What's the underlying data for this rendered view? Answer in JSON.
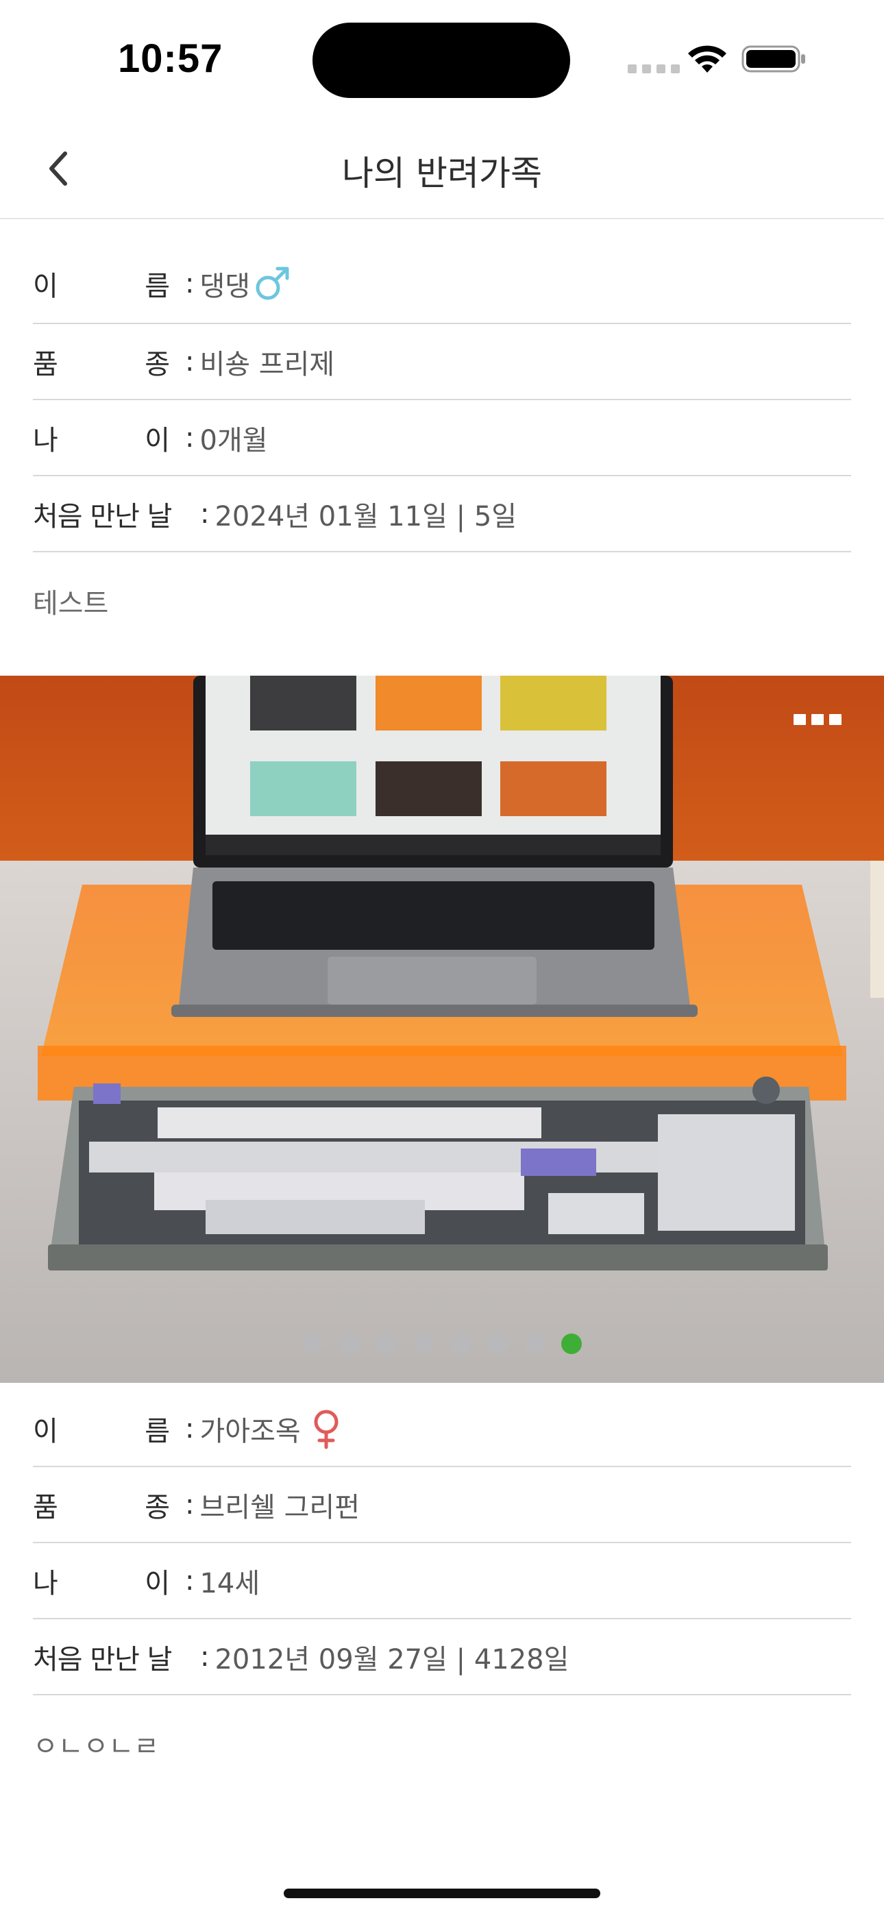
{
  "status_bar": {
    "time": "10:57"
  },
  "nav": {
    "title": "나의 반려가족"
  },
  "pets": [
    {
      "name_label_a": "이",
      "name_label_b": "름",
      "breed_label_a": "품",
      "breed_label_b": "종",
      "age_label_a": "나",
      "age_label_b": "이",
      "met_label": "처음 만난 날",
      "colon": ":",
      "name": "댕댕",
      "gender_icon": "male-icon",
      "breed": "비숑 프리제",
      "age": "0개월",
      "met": "2024년 01월 11일 | 5일",
      "memo": "테스트"
    },
    {
      "name_label_a": "이",
      "name_label_b": "름",
      "breed_label_a": "품",
      "breed_label_b": "종",
      "age_label_a": "나",
      "age_label_b": "이",
      "met_label": "처음 만난 날",
      "colon": ":",
      "name": "가아조옥",
      "gender_icon": "female-icon",
      "breed": "브리쉘 그리펀",
      "age": "14세",
      "met": "2012년 09월 27일 | 4128일",
      "memo": "ㅇㄴㅇㄴㄹ"
    }
  ],
  "carousel": {
    "page_count": 8,
    "active_page": 8
  },
  "colors": {
    "male": "#6cc6de",
    "female": "#e05a5a",
    "active_dot": "#3fae36",
    "inactive_dot": "#b9b9bb"
  }
}
